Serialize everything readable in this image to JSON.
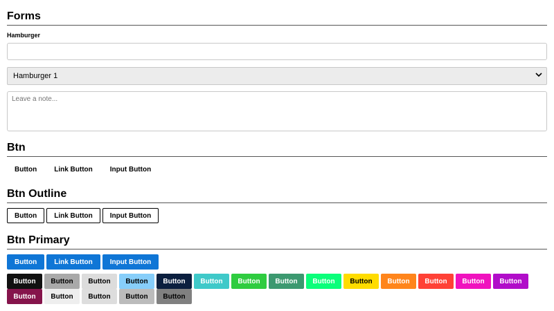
{
  "sections": {
    "forms": "Forms",
    "btn": "Btn",
    "btn_outline": "Btn Outline",
    "btn_primary": "Btn Primary"
  },
  "form": {
    "label": "Hamburger",
    "text_value": "",
    "select_value": "Hamburger 1",
    "textarea_placeholder": "Leave a note..."
  },
  "btn_labels": {
    "button": "Button",
    "link_button": "Link Button",
    "input_button": "Input Button"
  },
  "colors_row1": [
    {
      "label": "Button",
      "bg": "#111111",
      "fg": "#ffffff"
    },
    {
      "label": "Button",
      "bg": "#a9a9a9",
      "fg": "#000000"
    },
    {
      "label": "Button",
      "bg": "#dcdcdc",
      "fg": "#000000"
    },
    {
      "label": "Button",
      "bg": "#87cefa",
      "fg": "#000000"
    },
    {
      "label": "Button",
      "bg": "#0b1f3f",
      "fg": "#ffffff"
    },
    {
      "label": "Button",
      "bg": "#3fc9c9",
      "fg": "#ffffff"
    },
    {
      "label": "Button",
      "bg": "#2fcc40",
      "fg": "#ffffff"
    },
    {
      "label": "Button",
      "bg": "#3c9970",
      "fg": "#ffffff"
    },
    {
      "label": "Button",
      "bg": "#0aff7a",
      "fg": "#ffffff"
    },
    {
      "label": "Button",
      "bg": "#ffdc00",
      "fg": "#000000"
    },
    {
      "label": "Button",
      "bg": "#ff851b",
      "fg": "#ffffff"
    },
    {
      "label": "Button",
      "bg": "#ff4136",
      "fg": "#ffffff"
    },
    {
      "label": "Button",
      "bg": "#f012be",
      "fg": "#ffffff"
    },
    {
      "label": "Button",
      "bg": "#b10dc9",
      "fg": "#ffffff"
    }
  ],
  "colors_row2": [
    {
      "label": "Button",
      "bg": "#85144b",
      "fg": "#ffffff"
    },
    {
      "label": "Button",
      "bg": "#eeeeee",
      "fg": "#000000"
    },
    {
      "label": "Button",
      "bg": "#dddddd",
      "fg": "#000000"
    },
    {
      "label": "Button",
      "bg": "#bbbbbb",
      "fg": "#000000"
    },
    {
      "label": "Button",
      "bg": "#808080",
      "fg": "#000000"
    }
  ]
}
